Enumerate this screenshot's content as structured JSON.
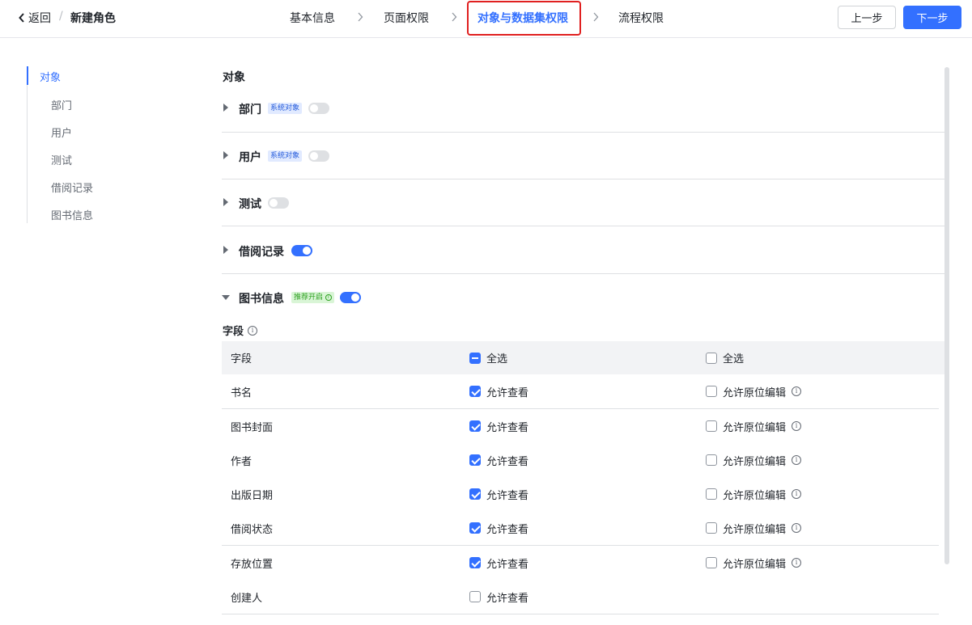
{
  "header": {
    "back_label": "返回",
    "separator": "/",
    "title": "新建角色",
    "steps": [
      "基本信息",
      "页面权限",
      "对象与数据集权限",
      "流程权限"
    ],
    "active_step": 2,
    "prev_label": "上一步",
    "next_label": "下一步"
  },
  "anchor_nav": {
    "items": [
      "对象",
      "部门",
      "用户",
      "测试",
      "借阅记录",
      "图书信息"
    ],
    "active": 0
  },
  "main": {
    "section_title": "对象",
    "objects": [
      {
        "name": "部门",
        "tag": "系统对象",
        "enabled": false,
        "expanded": false
      },
      {
        "name": "用户",
        "tag": "系统对象",
        "enabled": false,
        "expanded": false
      },
      {
        "name": "测试",
        "tag": "",
        "enabled": false,
        "expanded": false
      },
      {
        "name": "借阅记录",
        "tag": "",
        "enabled": true,
        "expanded": false
      },
      {
        "name": "图书信息",
        "tag": "推荐开启",
        "enabled": true,
        "expanded": true
      }
    ],
    "fields_label": "字段",
    "table": {
      "headers": [
        "字段",
        "全选",
        "全选"
      ],
      "view_label": "允许查看",
      "edit_label": "允许原位编辑",
      "rows": [
        {
          "field": "书名",
          "view": true,
          "edit": false
        },
        {
          "field": "图书封面",
          "view": true,
          "edit": false
        },
        {
          "field": "作者",
          "view": true,
          "edit": false
        },
        {
          "field": "出版日期",
          "view": true,
          "edit": false
        },
        {
          "field": "借阅状态",
          "view": true,
          "edit": false
        },
        {
          "field": "存放位置",
          "view": true,
          "edit": false
        },
        {
          "field": "创建人",
          "view": false,
          "edit": null
        }
      ]
    }
  },
  "colors": {
    "accent": "#3370ff",
    "highlight_border": "#e02020",
    "system_tag_bg": "#e1eaff",
    "recommend_tag_bg": "#d9f5d6"
  },
  "icons": [
    "chevron-left-icon",
    "chevron-right-icon",
    "caret-right-icon",
    "caret-down-icon",
    "info-icon"
  ]
}
